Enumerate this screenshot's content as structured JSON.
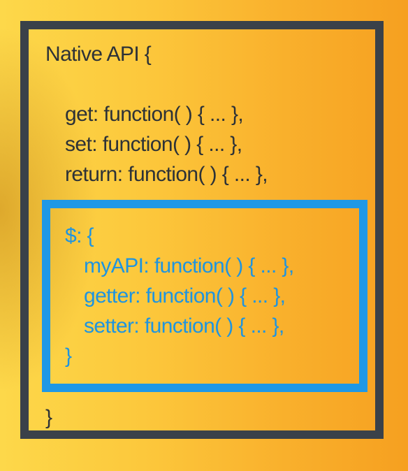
{
  "diagram": {
    "outer_header": "Native API {",
    "native_methods": [
      "get: function( ) { ... },",
      "set: function( ) { ... },",
      "return: function( ) { ... },"
    ],
    "inner_header": "$: {",
    "custom_methods": [
      "myAPI: function( ) { ... },",
      "getter: function( ) { ... },",
      "setter: function( ) { ... },"
    ],
    "inner_close": "}",
    "outer_close": "}"
  },
  "colors": {
    "background_left": "#fdd84a",
    "background_right": "#f6a020",
    "outer_border": "#3a4149",
    "inner_border": "#1f98e6",
    "dark_text": "#2d3237",
    "blue_text": "#1e94e0"
  }
}
